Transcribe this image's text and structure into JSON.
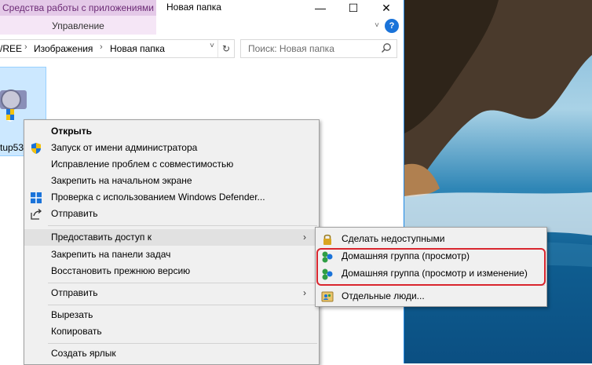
{
  "window": {
    "tool_tab_title": "Средства работы с приложениями",
    "tool_tab_sub": "Управление",
    "title": "Новая папка",
    "minimize": "—",
    "maximize": "☐",
    "close": "✕",
    "help": "?",
    "expand": "˅"
  },
  "address": {
    "crumbs": [
      "/REE",
      "Изображения",
      "Новая папка"
    ],
    "sep": "›",
    "dropdown": "˅",
    "refresh": "↻"
  },
  "search": {
    "placeholder": "Поиск: Новая папка"
  },
  "file": {
    "label": "tup53"
  },
  "context_menu": {
    "items": [
      {
        "label": "Открыть"
      },
      {
        "label": "Запуск от имени администратора"
      },
      {
        "label": "Исправление проблем с совместимостью"
      },
      {
        "label": "Закрепить на начальном экране"
      },
      {
        "label": "Проверка с использованием Windows Defender..."
      },
      {
        "label": "Отправить"
      },
      {
        "label": "Предоставить доступ к"
      },
      {
        "label": "Закрепить на панели задач"
      },
      {
        "label": "Восстановить прежнюю версию"
      },
      {
        "label": "Отправить"
      },
      {
        "label": "Вырезать"
      },
      {
        "label": "Копировать"
      },
      {
        "label": "Создать ярлык"
      }
    ],
    "arrow": "›"
  },
  "submenu": {
    "items": [
      {
        "label": "Сделать недоступными"
      },
      {
        "label": "Домашняя группа (просмотр)"
      },
      {
        "label": "Домашняя группа (просмотр и изменение)"
      },
      {
        "label": "Отдельные люди..."
      }
    ]
  },
  "colors": {
    "accent": "#1a73d9",
    "highlight_box": "#d9262e",
    "selection": "#cce8ff"
  }
}
